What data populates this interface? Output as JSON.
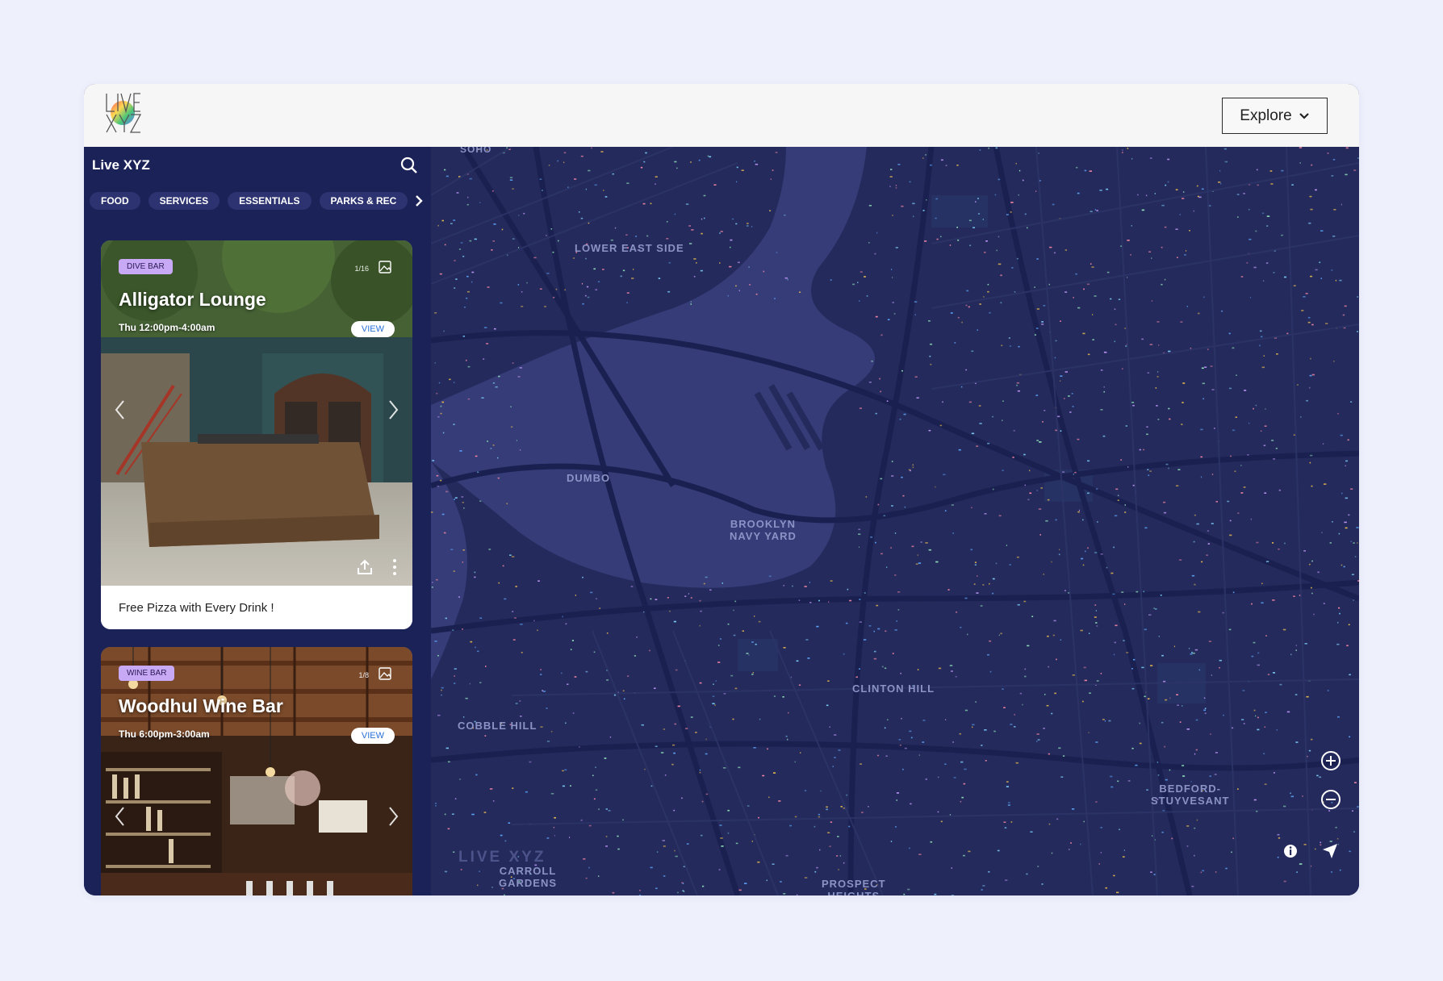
{
  "header": {
    "logo_alt": "LIVE XYZ",
    "explore_label": "Explore"
  },
  "sidebar": {
    "title": "Live XYZ",
    "categories": [
      "FOOD",
      "SERVICES",
      "ESSENTIALS",
      "PARKS & REC"
    ]
  },
  "cards": [
    {
      "tag": "DIVE BAR",
      "counter": "1/16",
      "name": "Alligator Lounge",
      "hours": "Thu 12:00pm-4:00am",
      "view_label": "VIEW",
      "footer": "Free Pizza with Every Drink !"
    },
    {
      "tag": "WINE BAR",
      "counter": "1/8",
      "name": "Woodhul Wine Bar",
      "hours": "Thu 6:00pm-3:00am",
      "view_label": "VIEW"
    }
  ],
  "map": {
    "labels": {
      "soho": "SOHO",
      "les": "LOWER EAST SIDE",
      "dumbo": "DUMBO",
      "navy_yard": "BROOKLYN\nNAVY YARD",
      "clinton_hill": "CLINTON HILL",
      "cobble_hill": "COBBLE HILL",
      "bed_stuy": "BEDFORD-\nSTUYVESANT",
      "carroll_gardens": "CARROLL\nGARDENS",
      "prospect_heights": "PROSPECT\nHEIGHTS"
    },
    "watermark": "LIVE XYZ"
  },
  "colors": {
    "page_bg": "#eef0fc",
    "sidebar_bg": "#1b2258",
    "map_land": "#242b5c",
    "map_water": "#353c78",
    "tag_bg": "#c7a9f5",
    "view_text": "#2a6fd9"
  },
  "icons": [
    "logo",
    "chevron-down-icon",
    "search-icon",
    "chevron-right-icon",
    "gallery-icon",
    "chevron-left-icon",
    "share-icon",
    "more-icon",
    "zoom-in-icon",
    "zoom-out-icon",
    "info-icon",
    "locate-icon"
  ]
}
